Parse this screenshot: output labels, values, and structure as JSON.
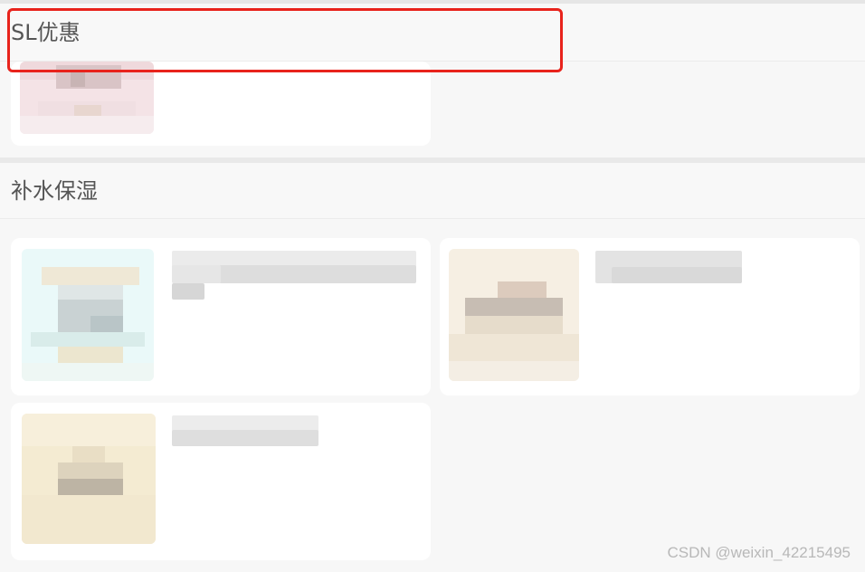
{
  "sections": [
    {
      "title": "SL优惠"
    },
    {
      "title": "补水保湿"
    }
  ],
  "watermark": "CSDN @weixin_42215495",
  "colors": {
    "highlight": "#e8231c",
    "card_bg": "#ffffff",
    "page_bg": "#f7f7f7"
  }
}
